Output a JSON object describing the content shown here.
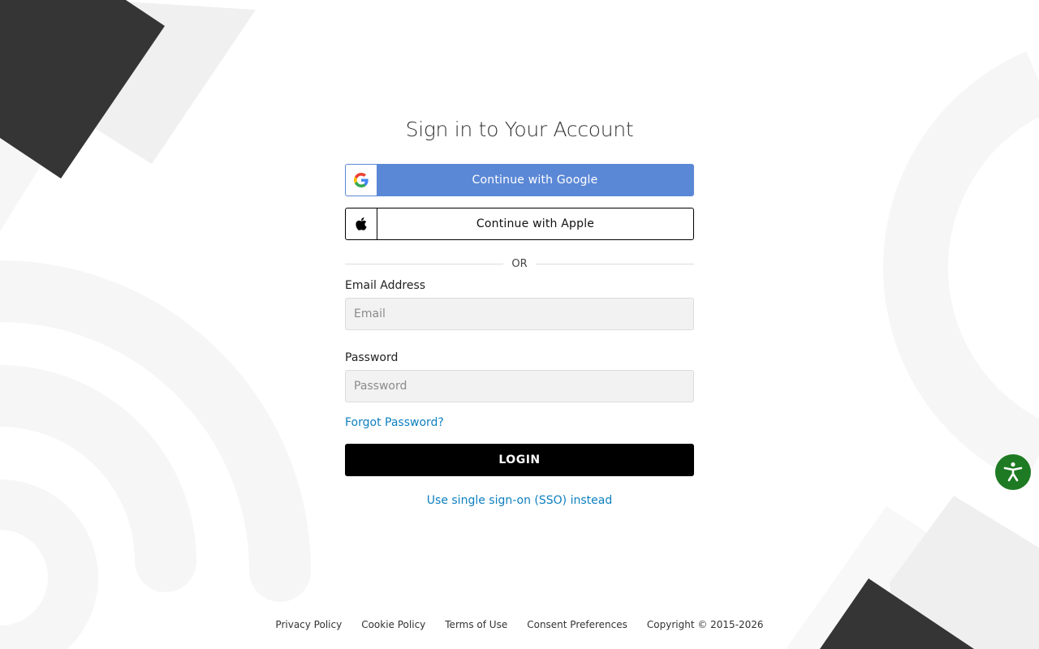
{
  "title": "Sign in to Your Account",
  "google_button": {
    "label": "Continue with Google",
    "icon": "google-icon"
  },
  "apple_button": {
    "label": "Continue with Apple",
    "icon": "apple-icon"
  },
  "divider": {
    "label": "OR"
  },
  "email_field": {
    "label": "Email Address",
    "placeholder": "Email",
    "value": ""
  },
  "password_field": {
    "label": "Password",
    "placeholder": "Password",
    "value": ""
  },
  "forgot_password": "Forgot Password?",
  "login_button": "LOGIN",
  "sso_link": "Use single sign-on (SSO) instead",
  "footer": {
    "privacy": "Privacy Policy",
    "cookie": "Cookie Policy",
    "terms": "Terms of Use",
    "consent": "Consent Preferences",
    "copyright": "Copyright © 2015-2026"
  },
  "accessibility_button": {
    "icon": "accessibility-icon"
  },
  "colors": {
    "google_blue": "#5b88d6",
    "link_blue": "#0d7fbf",
    "login_black": "#000000",
    "accessibility_green": "#1e7a23"
  }
}
